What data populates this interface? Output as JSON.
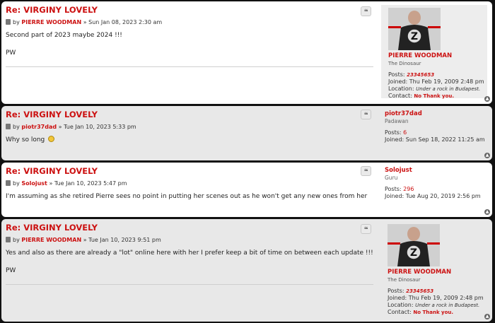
{
  "posts": [
    {
      "title": "Re: VIRGINY LOVELY",
      "by": "by",
      "author": "PIERRE WOODMAN",
      "sep": "»",
      "date": "Sun Jan 08, 2023 2:30 am",
      "lines": [
        "Second part of 2023 maybe 2024 !!!",
        "PW"
      ],
      "profile": {
        "username": "PIERRE WOODMAN",
        "rank": "The Dinosaur",
        "posts_label": "Posts:",
        "posts": "23345653",
        "joined_label": "Joined:",
        "joined": "Thu Feb 19, 2009 2:48 pm",
        "location_label": "Location:",
        "location": "Under a rock in Budapest.",
        "contact_label": "Contact:",
        "contact": "No Thank you."
      }
    },
    {
      "title": "Re: VIRGINY LOVELY",
      "by": "by",
      "author": "piotr37dad",
      "sep": "»",
      "date": "Tue Jan 10, 2023 5:33 pm",
      "lines": [
        "Why so long"
      ],
      "profile": {
        "username": "piotr37dad",
        "rank": "Padawan",
        "posts_label": "Posts:",
        "posts": "6",
        "joined_label": "Joined:",
        "joined": "Sun Sep 18, 2022 11:25 am"
      }
    },
    {
      "title": "Re: VIRGINY LOVELY",
      "by": "by",
      "author": "Solojust",
      "sep": "»",
      "date": "Tue Jan 10, 2023 5:47 pm",
      "lines": [
        "I'm assuming as she retired Pierre sees no point in putting her scenes out as he won't get any new ones from her"
      ],
      "profile": {
        "username": "Solojust",
        "rank": "Guru",
        "posts_label": "Posts:",
        "posts": "296",
        "joined_label": "Joined:",
        "joined": "Tue Aug 20, 2019 2:56 pm"
      }
    },
    {
      "title": "Re: VIRGINY LOVELY",
      "by": "by",
      "author": "PIERRE WOODMAN",
      "sep": "»",
      "date": "Tue Jan 10, 2023 9:51 pm",
      "lines": [
        "Yes and also as there are already a \"lot\" online here with her I prefer keep a bit of time on between each update !!!",
        "PW"
      ],
      "profile": {
        "username": "PIERRE WOODMAN",
        "rank": "The Dinosaur",
        "posts_label": "Posts:",
        "posts": "23345653",
        "joined_label": "Joined:",
        "joined": "Thu Feb 19, 2009 2:48 pm",
        "location_label": "Location:",
        "location": "Under a rock in Budapest.",
        "contact_label": "Contact:",
        "contact": "No Thank you."
      }
    }
  ],
  "icons": {
    "quote": "quote-icon",
    "top": "arrow-up-icon",
    "post": "post-doc-icon",
    "emoji": "confused-face-icon",
    "avatar": "z-logo-avatar"
  },
  "colors": {
    "accent": "#cc1111",
    "post_white": "#ffffff",
    "post_grey": "#e8e8e8"
  }
}
